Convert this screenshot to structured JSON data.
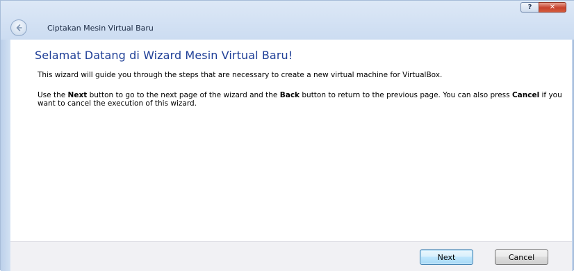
{
  "window": {
    "title": "Ciptakan Mesin Virtual Baru",
    "help_label": "?",
    "close_label": "✕"
  },
  "main": {
    "heading": "Selamat Datang di Wizard Mesin Virtual Baru!",
    "intro": "This wizard will guide you through the steps that are necessary to create a new virtual machine for VirtualBox.",
    "instructions": {
      "t1": "Use the ",
      "next_word": "Next",
      "t2": " button to go to the next page of the wizard and the ",
      "back_word": "Back",
      "t3": " button to return to the previous page. You can also press ",
      "cancel_word": "Cancel",
      "t4": " if you want to cancel the execution of this wizard."
    }
  },
  "footer": {
    "next_label": "Next",
    "cancel_label": "Cancel"
  },
  "colors": {
    "heading": "#1f3f97",
    "titlebar": "#d4e2f4",
    "close": "#c7422d",
    "footer": "#f1f1f4"
  },
  "icons": {
    "back": "back-arrow-icon",
    "help": "help-icon",
    "close": "close-icon"
  }
}
